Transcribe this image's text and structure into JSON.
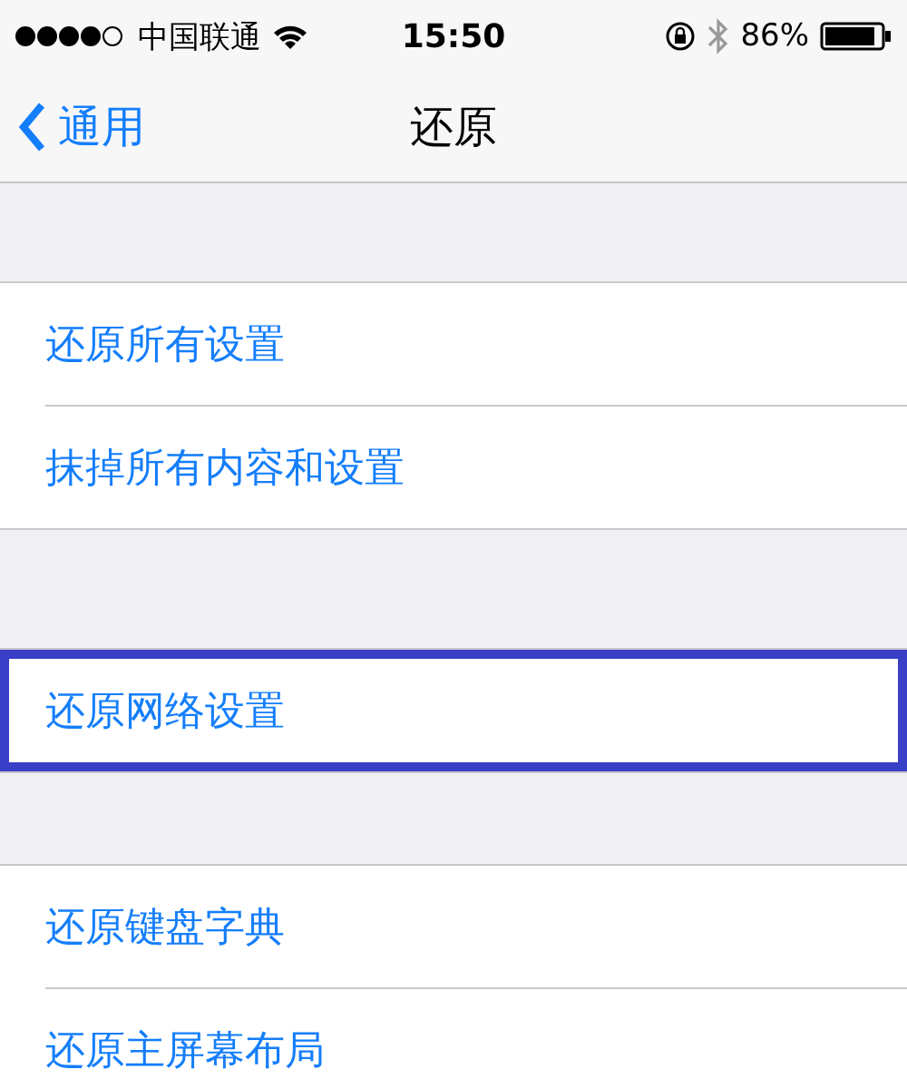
{
  "status_bar": {
    "carrier": "中国联通",
    "time": "15:50",
    "battery": "86%"
  },
  "nav": {
    "back": "通用",
    "title": "还原"
  },
  "groups": [
    {
      "items": [
        {
          "label": "还原所有设置",
          "selected": false
        },
        {
          "label": "抹掉所有内容和设置",
          "selected": false
        }
      ]
    },
    {
      "items": [
        {
          "label": "还原网络设置",
          "selected": true
        }
      ]
    },
    {
      "items": [
        {
          "label": "还原键盘字典",
          "selected": false
        },
        {
          "label": "还原主屏幕布局",
          "selected": false
        }
      ]
    }
  ]
}
